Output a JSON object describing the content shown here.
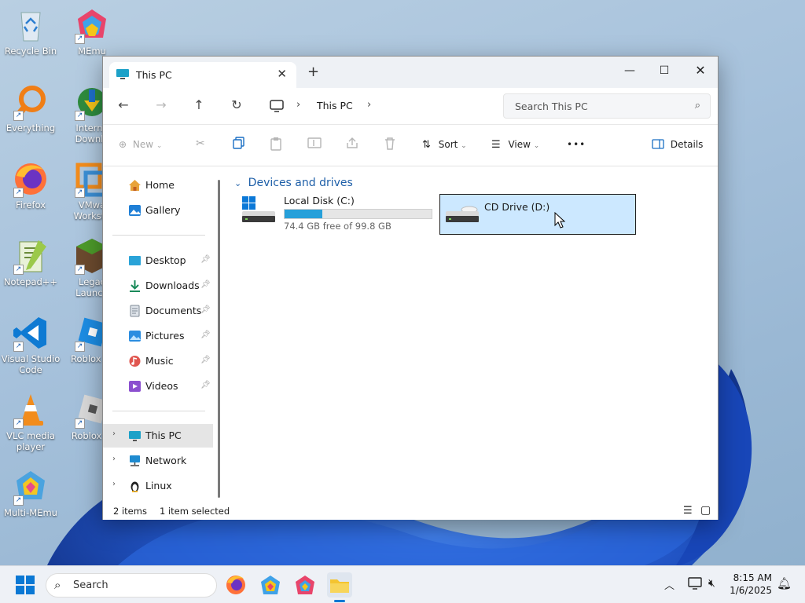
{
  "desktop": {
    "icons_col1": [
      {
        "label": "Recycle Bin",
        "icon": "recycle-bin-icon"
      },
      {
        "label": "Everything",
        "icon": "everything-icon"
      },
      {
        "label": "Firefox",
        "icon": "firefox-icon"
      },
      {
        "label": "Notepad++",
        "icon": "notepadpp-icon"
      },
      {
        "label": "Visual Studio Code",
        "icon": "vscode-icon"
      },
      {
        "label": "VLC media player",
        "icon": "vlc-icon"
      },
      {
        "label": "Multi-MEmu",
        "icon": "multi-memu-icon"
      }
    ],
    "icons_col2": [
      {
        "label": "MEmu",
        "icon": "memu-icon"
      },
      {
        "label": "Interne Downlo",
        "icon": "idm-icon"
      },
      {
        "label": "VMwa Worksta",
        "icon": "vmware-icon"
      },
      {
        "label": "Legac Launch",
        "icon": "legacy-launcher-icon"
      },
      {
        "label": "Roblox St",
        "icon": "roblox-studio-icon"
      },
      {
        "label": "Roblox Pl",
        "icon": "roblox-player-icon"
      }
    ]
  },
  "window": {
    "tab_title": "This PC",
    "new_tab": "+",
    "breadcrumb": "This PC",
    "search_placeholder": "Search This PC",
    "commands": {
      "new": "New",
      "sort": "Sort",
      "view": "View",
      "more": "•••",
      "details": "Details"
    },
    "sidebar": [
      {
        "label": "Home",
        "icon": "home-icon"
      },
      {
        "label": "Gallery",
        "icon": "gallery-icon"
      },
      {
        "label": "Desktop",
        "icon": "desktop-folder-icon",
        "pinned": true
      },
      {
        "label": "Downloads",
        "icon": "downloads-icon",
        "pinned": true
      },
      {
        "label": "Documents",
        "icon": "documents-icon",
        "pinned": true
      },
      {
        "label": "Pictures",
        "icon": "pictures-icon",
        "pinned": true
      },
      {
        "label": "Music",
        "icon": "music-icon",
        "pinned": true
      },
      {
        "label": "Videos",
        "icon": "videos-icon",
        "pinned": true
      },
      {
        "label": "This PC",
        "icon": "this-pc-icon",
        "selected": true
      },
      {
        "label": "Network",
        "icon": "network-icon"
      },
      {
        "label": "Linux",
        "icon": "linux-icon"
      }
    ],
    "section_title": "Devices and drives",
    "drives": [
      {
        "name": "Local Disk (C:)",
        "free_text": "74.4 GB free of 99.8 GB",
        "used_fraction": 0.255
      },
      {
        "name": "CD Drive (D:)",
        "selected": true
      }
    ],
    "status": {
      "items": "2 items",
      "selected": "1 item selected"
    }
  },
  "taskbar": {
    "search_label": "Search",
    "time": "8:15 AM",
    "date": "1/6/2025"
  },
  "colors": {
    "accent": "#0078d4",
    "selection": "#cce8ff",
    "selection_border": "#1f1f1f"
  }
}
